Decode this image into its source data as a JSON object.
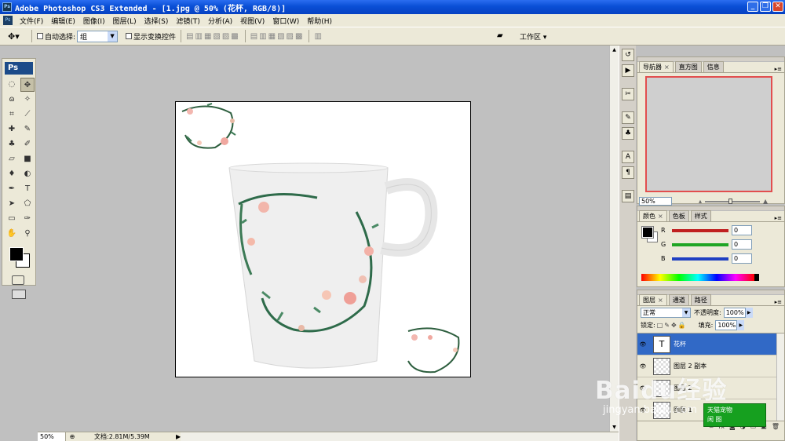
{
  "window": {
    "title": "Adobe Photoshop CS3 Extended - [1.jpg @ 50% (花杯, RGB/8)]",
    "app_icon": "Ps",
    "controls": [
      "minimize",
      "restore",
      "close"
    ]
  },
  "menu": [
    "文件(F)",
    "编辑(E)",
    "图像(I)",
    "图层(L)",
    "选择(S)",
    "滤镜(T)",
    "分析(A)",
    "视图(V)",
    "窗口(W)",
    "帮助(H)"
  ],
  "options": {
    "auto_select_label": "自动选择:",
    "auto_select_value": "组",
    "show_transform_label": "显示变换控件",
    "workspace_label": "工作区"
  },
  "toolbox": {
    "logo": "Ps",
    "tools": [
      "marquee-icon",
      "move-icon",
      "lasso-icon",
      "magic-wand-icon",
      "crop-icon",
      "eyedropper-icon",
      "healing-icon",
      "brush-icon",
      "stamp-icon",
      "history-brush-icon",
      "eraser-icon",
      "gradient-icon",
      "blur-icon",
      "dodge-icon",
      "pen-icon",
      "type-icon",
      "path-select-icon",
      "shape-icon",
      "notes-icon",
      "eyedropper2-icon",
      "hand-icon",
      "zoom-icon"
    ],
    "foreground_color": "#000000",
    "background_color": "#ffffff"
  },
  "document": {
    "canvas_image": "white ceramic mug with green leaf and pink flower wreath decoration",
    "status_zoom": "50%",
    "status_doc": "文档:2.81M/5.39M"
  },
  "navigator_panel": {
    "tabs": [
      "导航器",
      "直方图",
      "信息"
    ],
    "zoom": "50%"
  },
  "color_panel": {
    "tabs": [
      "颜色",
      "色板",
      "样式"
    ],
    "channels": [
      {
        "label": "R",
        "value": "0",
        "color": "#cc2222"
      },
      {
        "label": "G",
        "value": "0",
        "color": "#22aa22"
      },
      {
        "label": "B",
        "value": "0",
        "color": "#2244cc"
      }
    ]
  },
  "layers_panel": {
    "tabs": [
      "图层",
      "通道",
      "路径"
    ],
    "blend_mode": "正常",
    "opacity_label": "不透明度:",
    "opacity": "100%",
    "lock_label": "锁定:",
    "fill_label": "填充:",
    "fill": "100%",
    "layers": [
      {
        "name": "花杯",
        "type": "text",
        "selected": true
      },
      {
        "name": "图层 2 副本",
        "type": "raster",
        "selected": false
      },
      {
        "name": "图层 2",
        "type": "raster",
        "selected": false
      },
      {
        "name": "图层 1",
        "type": "raster",
        "selected": false
      }
    ]
  },
  "watermark": {
    "logo": "Baidu经验",
    "url": "jingyan.baidu.com",
    "badge_line1": "天猫宠物",
    "badge_line2": "闲 图"
  }
}
